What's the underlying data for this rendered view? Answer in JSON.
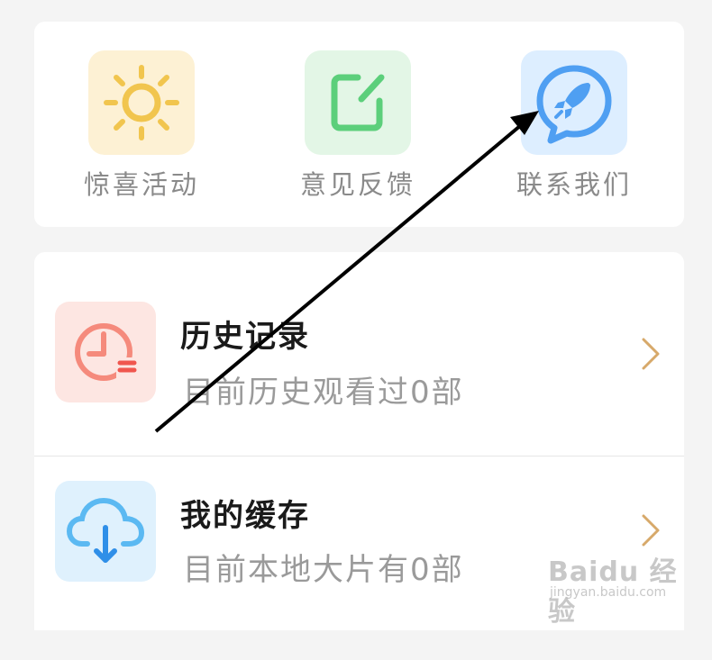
{
  "quick_actions": [
    {
      "label": "惊喜活动",
      "icon": "sun-icon",
      "bg": "#fdf1d4"
    },
    {
      "label": "意见反馈",
      "icon": "edit-note-icon",
      "bg": "#e3f6e6"
    },
    {
      "label": "联系我们",
      "icon": "rocket-chat-icon",
      "bg": "#ddeeff"
    }
  ],
  "list": {
    "history": {
      "title": "历史记录",
      "subtitle": "目前历史观看过0部",
      "icon": "clock-history-icon"
    },
    "cache": {
      "title": "我的缓存",
      "subtitle": "目前本地大片有0部",
      "icon": "cloud-download-icon"
    }
  },
  "watermark": {
    "main": "Baidu 经验",
    "sub": "jingyan.baidu.com"
  },
  "colors": {
    "chevron": "#d7a96a",
    "arrow": "#000000"
  }
}
